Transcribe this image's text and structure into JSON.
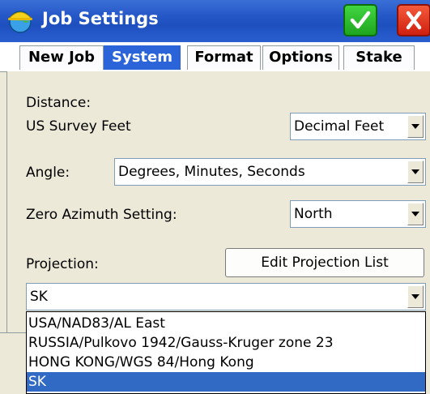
{
  "window": {
    "title": "Job Settings",
    "icon": "globe-hardhat-icon",
    "ok_icon": "checkmark-icon",
    "close_icon": "close-x-icon"
  },
  "tabs": [
    {
      "label": "New Job",
      "active": false
    },
    {
      "label": "System",
      "active": true
    },
    {
      "label": "Format",
      "active": false
    },
    {
      "label": "Options",
      "active": false
    },
    {
      "label": "Stake",
      "active": false
    }
  ],
  "system": {
    "distance_label": "Distance:",
    "distance_units": "US Survey Feet",
    "distance_format": "Decimal Feet",
    "angle_label": "Angle:",
    "angle_value": "Degrees, Minutes, Seconds",
    "zero_azimuth_label": "Zero Azimuth Setting:",
    "zero_azimuth_value": "North",
    "projection_label": "Projection:",
    "edit_projection_button": "Edit Projection List",
    "projection_value": "SK",
    "projection_options": [
      "USA/NAD83/AL East",
      "RUSSIA/Pulkovo 1942/Gauss-Kruger zone 23",
      "HONG KONG/WGS 84/Hong Kong",
      "SK"
    ],
    "projection_selected": "SK"
  },
  "colors": {
    "titlebar": "#2456c6",
    "active_tab": "#2b64d8",
    "selection": "#316ac5",
    "ok_green": "#1fa51f",
    "close_red": "#cf1f10"
  }
}
